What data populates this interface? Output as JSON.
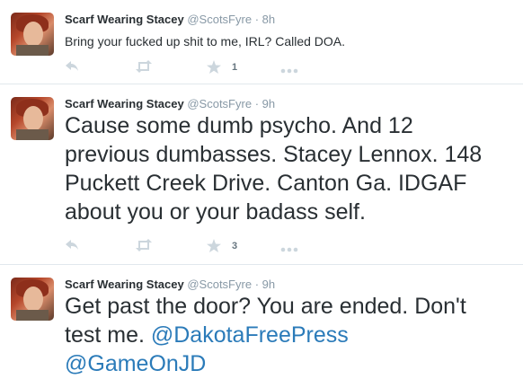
{
  "tweets": [
    {
      "fullname": "Scarf Wearing Stacey",
      "handle": "@ScotsFyre",
      "time": "· 8h",
      "lines": [
        "Bring your fucked up shit to me, IRL? Called DOA."
      ],
      "actions": {
        "reply_icon": "reply-icon",
        "retweet_icon": "retweet-icon",
        "favorite_icon": "star-icon",
        "favorite_count": "1",
        "more_icon": "more-icon"
      }
    },
    {
      "fullname": "Scarf Wearing Stacey",
      "handle": "@ScotsFyre",
      "time": "· 9h",
      "lines": [
        "Cause some dumb psycho.  And 12",
        "previous dumbasses. Stacey Lennox. 148",
        "Puckett Creek Drive. Canton Ga. IDGAF",
        "about you or your badass self."
      ],
      "actions": {
        "reply_icon": "reply-icon",
        "retweet_icon": "retweet-icon",
        "favorite_icon": "star-icon",
        "favorite_count": "3",
        "more_icon": "more-icon"
      }
    },
    {
      "fullname": "Scarf Wearing Stacey",
      "handle": "@ScotsFyre",
      "time": "· 9h",
      "line1": "Get past the door? You are ended. Don't",
      "line2_text": "test me. ",
      "mention1": "@DakotaFreePress",
      "mention2": "@GameOnJD"
    }
  ],
  "colors": {
    "link": "#2b7bb9",
    "name": "#292f33",
    "muted": "#8899a6",
    "icon": "#ccd6dd",
    "divider": "#e1e8ed"
  }
}
